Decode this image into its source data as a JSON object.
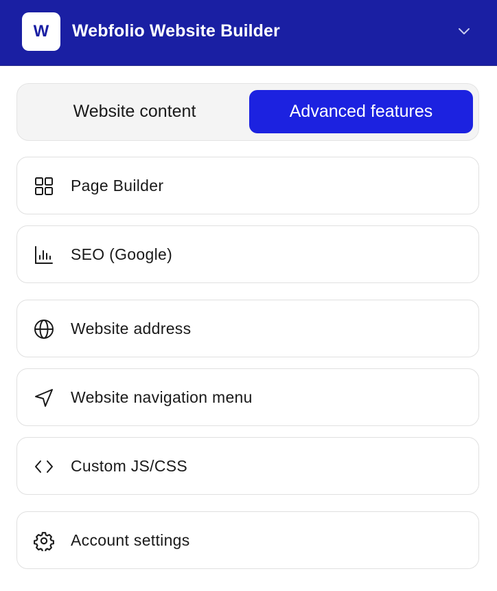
{
  "header": {
    "logo_letter": "W",
    "title": "Webfolio Website Builder",
    "chevron_icon": "chevron-down-icon"
  },
  "tabs": [
    {
      "label": "Website content",
      "active": false
    },
    {
      "label": "Advanced features",
      "active": true
    }
  ],
  "menu": [
    {
      "label": "Page Builder",
      "icon": "grid-icon"
    },
    {
      "label": "SEO (Google)",
      "icon": "bar-chart-icon"
    },
    {
      "label": "Website address",
      "icon": "globe-icon"
    },
    {
      "label": "Website navigation menu",
      "icon": "navigation-arrow-icon"
    },
    {
      "label": "Custom JS/CSS",
      "icon": "code-icon"
    },
    {
      "label": "Account settings",
      "icon": "gear-icon"
    }
  ],
  "colors": {
    "header_bg": "#1a1fa3",
    "active_tab_bg": "#1c22e0",
    "text": "#1a1a1a"
  }
}
